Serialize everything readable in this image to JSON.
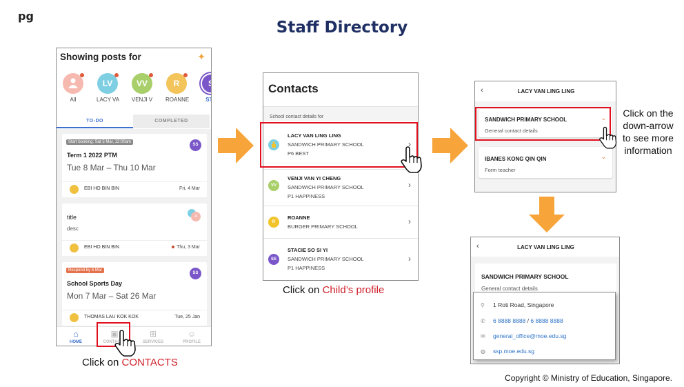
{
  "logo": "pg",
  "title": "Staff Directory",
  "copyright": "Copyright © Ministry of Education, Singapore.",
  "colors": {
    "accent": "#3c6fd0",
    "highlight": "#e0101e",
    "arrow": "#f7a53a",
    "title": "#1f2f63"
  },
  "step1": {
    "header": "Showing posts for",
    "star_icon": "sparkle-icon",
    "avatars": [
      {
        "label": "All",
        "initials": "",
        "color": "#f6b9b0"
      },
      {
        "label": "LACY VA",
        "initials": "LV",
        "color": "#7fcfe3"
      },
      {
        "label": "VENJI V",
        "initials": "VV",
        "color": "#a9cf6a"
      },
      {
        "label": "ROANNE",
        "initials": "R",
        "color": "#f2c45a"
      },
      {
        "label": "STA",
        "initials": "S",
        "color": "#7a56c8"
      }
    ],
    "tabs": {
      "todo": "TO-DO",
      "completed": "COMPLETED"
    },
    "posts": [
      {
        "chip": "Start booking: Sat 5 Mar, 12:00am",
        "title": "Term 1 2022 PTM",
        "dates": "Tue 8 Mar – Thu 10 Mar",
        "badge": "SS",
        "author": "EBI HO BIN BIN",
        "date": "Fri, 4 Mar"
      },
      {
        "title": "title",
        "desc": "desc",
        "badge": "4",
        "author": "EBI HO BIN BIN",
        "date": "Thu, 3 Mar"
      },
      {
        "chip": "Respond by 6 Mar",
        "title": "School Sports Day",
        "dates": "Mon 7 Mar – Sat 26 Mar",
        "badge": "SS",
        "author": "THOMAS LAU KOK KOK",
        "date": "Tue, 25 Jan"
      }
    ],
    "nav": [
      {
        "label": "HOME",
        "icon": "home-icon"
      },
      {
        "label": "CONTACTS",
        "icon": "contacts-icon"
      },
      {
        "label": "SERVICES",
        "icon": "grid-icon"
      },
      {
        "label": "PROFILE",
        "icon": "profile-icon"
      }
    ],
    "caption_prefix": "Click on ",
    "caption_highlight": "CONTACTS"
  },
  "step2": {
    "title": "Contacts",
    "subtitle": "School contact details for",
    "contacts": [
      {
        "name": "LACY VAN LING LING",
        "school": "SANDWICH PRIMARY SCHOOL",
        "class": "P6 BEST",
        "initials": "L",
        "color": "#7fcfe3"
      },
      {
        "name": "VENJI VAN YI CHENG",
        "school": "SANDWICH PRIMARY SCHOOL",
        "class": "P1 HAPPINESS",
        "initials": "VV",
        "color": "#a9cf6a"
      },
      {
        "name": "ROANNE",
        "school": "BURGER PRIMARY SCHOOL",
        "class": "",
        "initials": "R",
        "color": "#f2c42a"
      },
      {
        "name": "STACIE SO SI YI",
        "school": "SANDWICH PRIMARY SCHOOL",
        "class": "P1 HAPPINESS",
        "initials": "SS",
        "color": "#7a56c8"
      }
    ],
    "caption_prefix": "Click on ",
    "caption_highlight": "Child’s profile"
  },
  "step3": {
    "child_name": "LACY VAN LING LING",
    "cards": [
      {
        "title": "SANDWICH PRIMARY SCHOOL",
        "desc": "General contact details"
      },
      {
        "title": "IBANES KONG QIN QIN",
        "desc": "Form teacher"
      }
    ],
    "instruction": "Click on the down-arrow to see more information"
  },
  "step4": {
    "child_name": "LACY VAN LING LING",
    "school": "SANDWICH PRIMARY SCHOOL",
    "desc": "General contact details",
    "address": "1 Roti Road, Singapore",
    "phone1": "6 8888 8888",
    "phone_sep": "/",
    "phone2": "6 8888 8888",
    "email": "general_office@moe.edu.sg",
    "website": "ssp.moe.edu.sg"
  }
}
